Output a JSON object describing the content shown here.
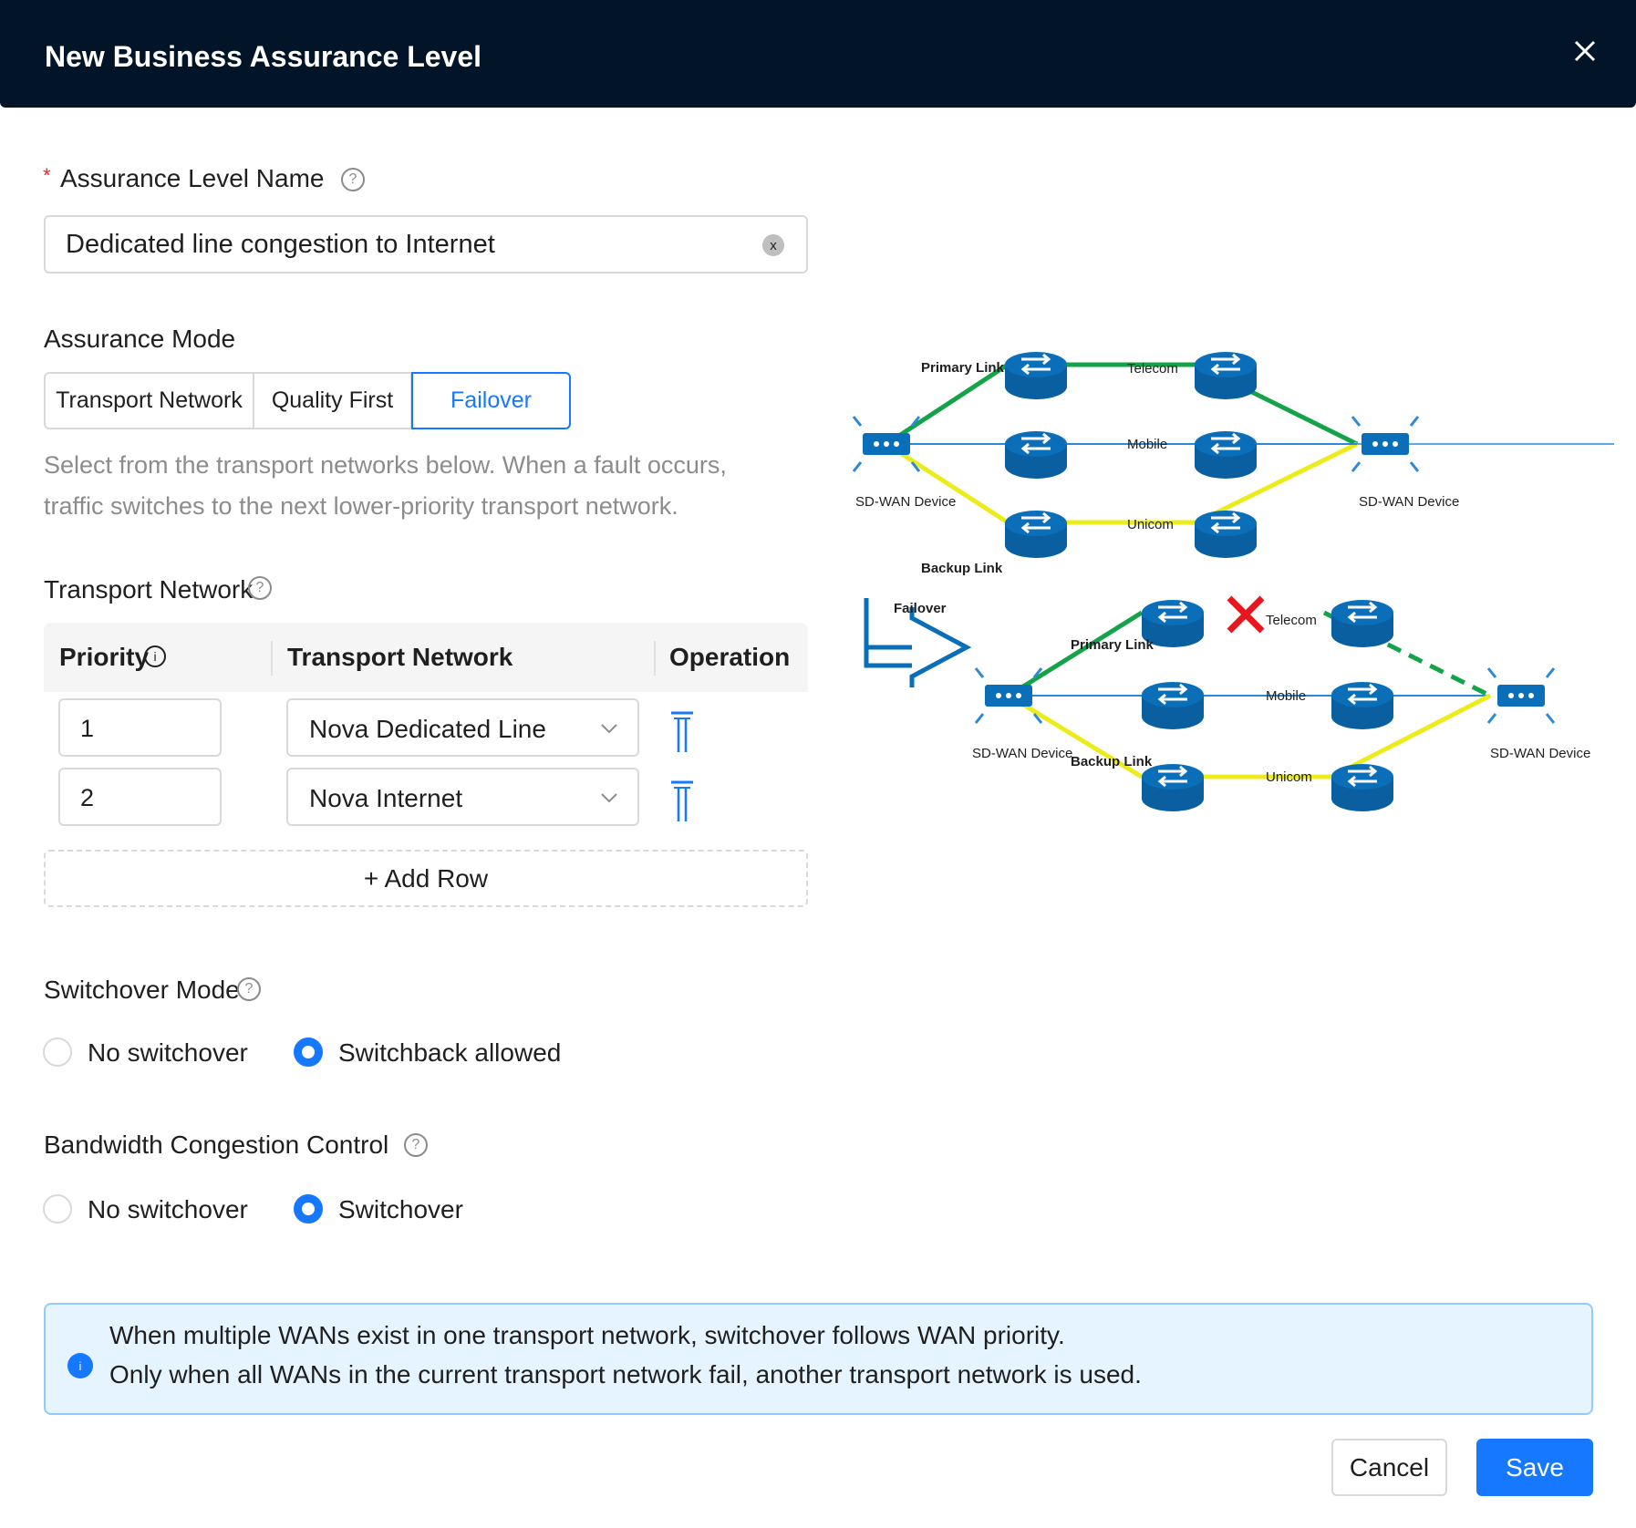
{
  "dialog": {
    "title": "New Business Assurance Level"
  },
  "name_field": {
    "required_mark": "*",
    "label": "Assurance Level Name",
    "value": "Dedicated line congestion to Internet",
    "clear_glyph": "x"
  },
  "mode": {
    "label": "Assurance Mode",
    "options": [
      "Transport Network",
      "Quality First",
      "Failover"
    ],
    "selected": "Failover",
    "description": "Select from the transport networks below. When a fault occurs, traffic switches to the next lower-priority transport network."
  },
  "transport": {
    "label": "Transport Network",
    "columns": {
      "priority": "Priority",
      "network": "Transport Network",
      "operation": "Operation"
    },
    "rows": [
      {
        "priority": "1",
        "network": "Nova Dedicated Line"
      },
      {
        "priority": "2",
        "network": "Nova Internet"
      }
    ],
    "add_row": "+ Add Row"
  },
  "switchover_mode": {
    "label": "Switchover Mode",
    "options": [
      "No switchover",
      "Switchback allowed"
    ],
    "selected": "Switchback allowed"
  },
  "bandwidth": {
    "label": "Bandwidth Congestion Control",
    "options": [
      "No switchover",
      "Switchover"
    ],
    "selected": "Switchover"
  },
  "alert": {
    "line1": "When multiple WANs exist in one transport network, switchover follows WAN priority.",
    "line2": "Only when all WANs in the current transport network fail, another transport network is used."
  },
  "buttons": {
    "cancel": "Cancel",
    "save": "Save"
  },
  "diagram": {
    "top": {
      "primary_link": "Primary Link",
      "backup_link": "Backup Link",
      "telecom": "Telecom",
      "mobile": "Mobile",
      "unicom": "Unicom",
      "device_left": "SD-WAN Device",
      "device_right": "SD-WAN Device"
    },
    "failover_label": "Failover",
    "bottom": {
      "primary_link": "Primary Link",
      "backup_link": "Backup Link",
      "telecom": "Telecom",
      "mobile": "Mobile",
      "unicom": "Unicom",
      "device_left": "SD-WAN Device",
      "device_right": "SD-WAN Device"
    },
    "colors": {
      "primary": "#15a34a",
      "backup": "#ecec1c",
      "mobile": "#2a8ad8",
      "router": "#0a6fb8",
      "fault": "#e8171f"
    }
  },
  "colors": {
    "header_bg": "#011428",
    "accent": "#1677ff",
    "alert_bg": "#e6f4ff",
    "required": "#f5222d"
  }
}
